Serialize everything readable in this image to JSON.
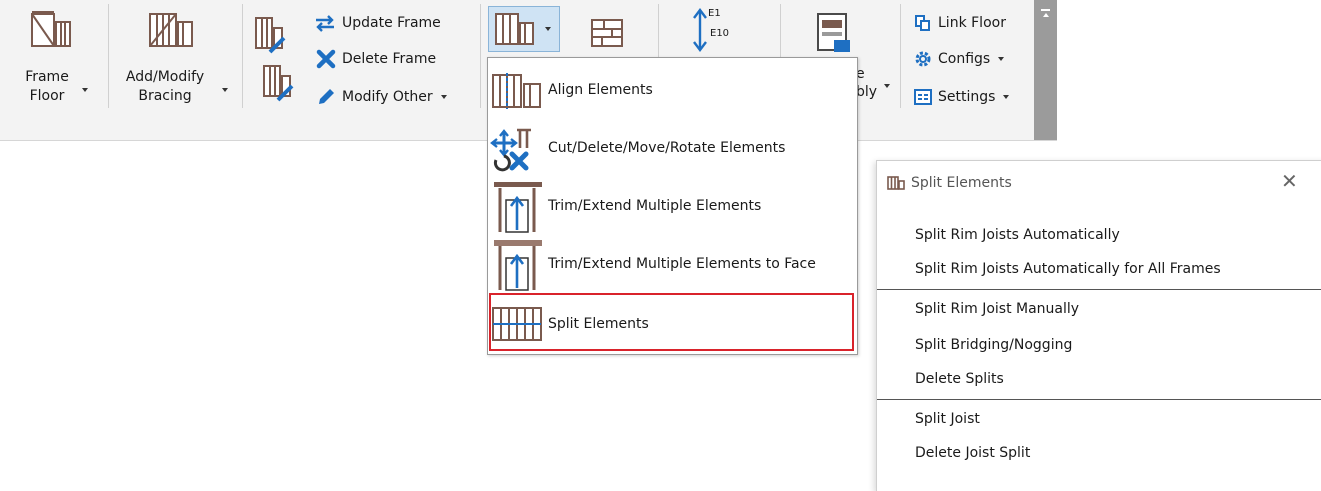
{
  "ribbon": {
    "frame_floor": {
      "line1": "Frame",
      "line2": "Floor"
    },
    "add_modify_bracing": {
      "line1": "Add/Modify",
      "line2": "Bracing"
    },
    "update_frame": "Update Frame",
    "delete_frame": "Delete Frame",
    "modify_other": "Modify Other",
    "e1_label": "E1",
    "e10_label": "E10",
    "assembly_partial_1": "e",
    "assembly_partial_2": "bly",
    "link_floor": "Link Floor",
    "configs": "Configs",
    "settings": "Settings"
  },
  "dropdown": {
    "items": [
      {
        "label": "Align Elements",
        "icon": "align-elements-icon"
      },
      {
        "label": "Cut/Delete/Move/Rotate Elements",
        "icon": "cut-move-rotate-icon"
      },
      {
        "label": "Trim/Extend Multiple Elements",
        "icon": "trim-extend-icon"
      },
      {
        "label": "Trim/Extend Multiple Elements to Face",
        "icon": "trim-extend-face-icon"
      },
      {
        "label": "Split Elements",
        "icon": "split-elements-icon"
      }
    ],
    "highlighted_index": 4
  },
  "panel": {
    "title": "Split Elements",
    "close": "✕",
    "groups": [
      [
        "Split Rim Joists Automatically",
        "Split Rim Joists Automatically for All Frames"
      ],
      [
        "Split Rim Joist Manually",
        "Split Bridging/Nogging",
        "Delete Splits"
      ],
      [
        "Split Joist",
        "Delete Joist Split"
      ]
    ]
  },
  "colors": {
    "ribbon_bg": "#f3f3f3",
    "icon_brown": "#7a5a4e",
    "icon_blue": "#1e6fc2",
    "highlight_red": "#d9232b",
    "active_button": "#cfe3f4"
  }
}
